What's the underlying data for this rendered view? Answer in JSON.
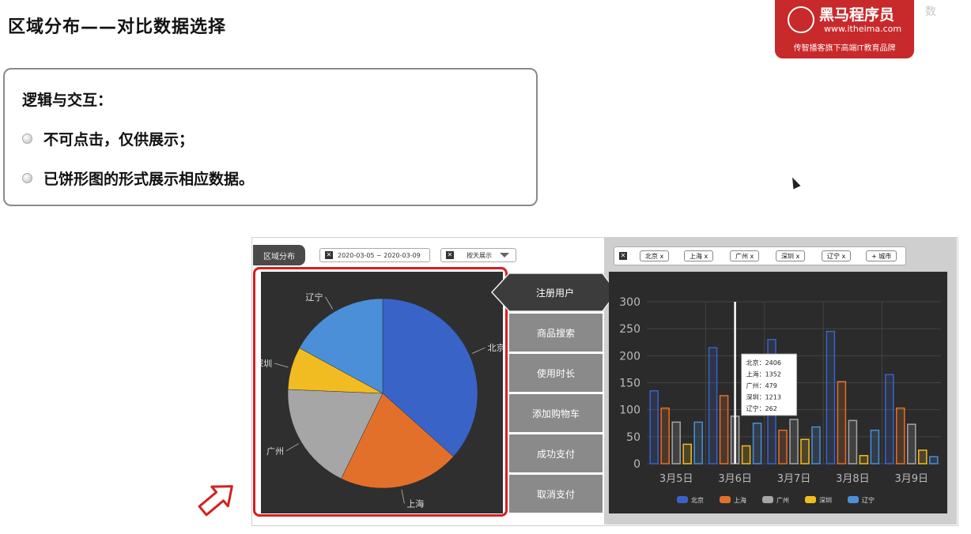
{
  "page": {
    "title": "区域分布——对比数据选择",
    "corner_text": "数"
  },
  "logo": {
    "brand": "黑马程序员",
    "url": "www.itheima.com",
    "slogan": "传智播客旗下高端IT教育品牌"
  },
  "logic": {
    "heading": "逻辑与交互：",
    "bullets": [
      "不可点击，仅供展示；",
      "已饼形图的形式展示相应数据。"
    ]
  },
  "toolbar": {
    "tab_label": "区域分布",
    "date_range": "2020-03-05 ~ 2020-03-09",
    "period_select": "按天展示"
  },
  "city_filter": {
    "chips": [
      "北京 x",
      "上海 x",
      "广州 x",
      "深圳 x",
      "辽宁 x"
    ],
    "add_label": "+ 城市"
  },
  "metrics_menu": [
    "注册用户",
    "商品搜索",
    "使用时长",
    "添加购物车",
    "成功支付",
    "取消支付"
  ],
  "colors": {
    "beijing": "#3a63c8",
    "shanghai": "#e3702a",
    "guangzhou": "#a6a6a6",
    "shenzhen": "#f1bc21",
    "liaoning": "#4b8fd8",
    "highlight": "#d42020"
  },
  "chart_data": [
    {
      "type": "pie",
      "labels": [
        "北京",
        "上海",
        "广州",
        "深圳",
        "辽宁"
      ],
      "values": [
        2406,
        1352,
        1213,
        479,
        1120
      ]
    },
    {
      "type": "bar",
      "categories": [
        "3月5日",
        "3月6日",
        "3月7日",
        "3月8日",
        "3月9日"
      ],
      "ylim": [
        0,
        300
      ],
      "yticks": [
        0,
        50,
        100,
        150,
        200,
        250,
        300
      ],
      "legend_position": "bottom",
      "series": [
        {
          "name": "北京",
          "values": [
            135,
            215,
            230,
            245,
            165
          ]
        },
        {
          "name": "上海",
          "values": [
            103,
            126,
            62,
            152,
            103
          ]
        },
        {
          "name": "广州",
          "values": [
            77,
            88,
            82,
            80,
            73
          ]
        },
        {
          "name": "深圳",
          "values": [
            36,
            33,
            45,
            15,
            25
          ]
        },
        {
          "name": "辽宁",
          "values": [
            77,
            75,
            68,
            62,
            13
          ]
        }
      ],
      "tooltip": {
        "lines": [
          "北京：2406",
          "上海：1352",
          "广州：479",
          "深圳：1213",
          "辽宁：262"
        ]
      }
    }
  ]
}
